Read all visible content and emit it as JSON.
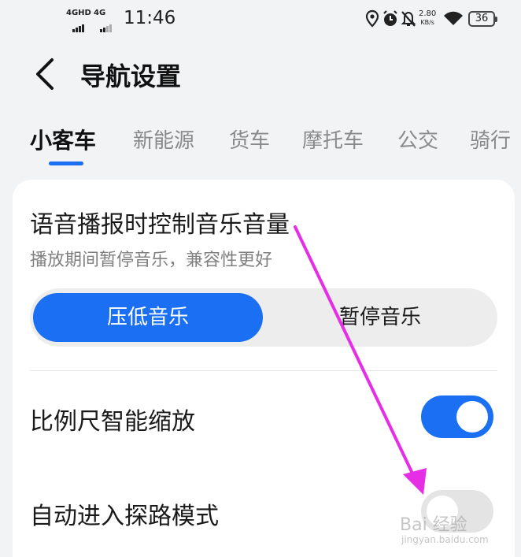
{
  "status_bar": {
    "signal1": "4GHD",
    "signal2": "4G",
    "time": "11:46",
    "net_speed_value": "2.80",
    "net_speed_unit": "KB/s",
    "battery": "36",
    "icons": [
      "location-icon",
      "alarm-icon",
      "mute-icon",
      "wifi-icon"
    ]
  },
  "header": {
    "title": "导航设置"
  },
  "tabs": [
    {
      "label": "小客车",
      "active": true
    },
    {
      "label": "新能源",
      "active": false
    },
    {
      "label": "货车",
      "active": false
    },
    {
      "label": "摩托车",
      "active": false
    },
    {
      "label": "公交",
      "active": false
    },
    {
      "label": "骑行",
      "active": false
    }
  ],
  "settings": {
    "voice": {
      "title": "语音播报时控制音乐音量",
      "subtitle": "播放期间暂停音乐，兼容性更好",
      "options": [
        "压低音乐",
        "暂停音乐"
      ],
      "selected": "压低音乐"
    },
    "scale": {
      "title": "比例尺智能缩放",
      "enabled": true
    },
    "explore": {
      "title": "自动进入探路模式",
      "enabled": false
    }
  },
  "watermark": {
    "text": "Bai 经验",
    "sub": "jingyan.baidu.com"
  },
  "colors": {
    "accent": "#1a6ff2",
    "annotation": "#e62ee6",
    "background": "#f1f3f5"
  }
}
